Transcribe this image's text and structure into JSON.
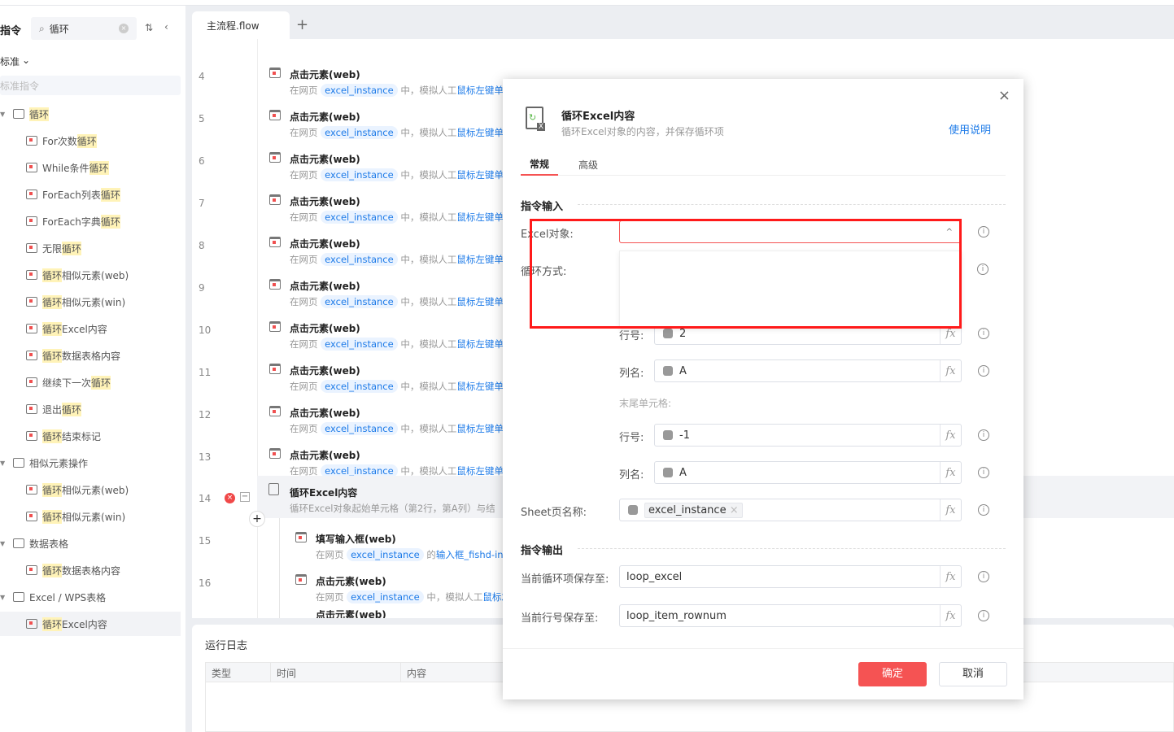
{
  "sidebar": {
    "title": "指令",
    "search_value": "循环",
    "filter": "标准",
    "category_placeholder": "标准指令",
    "items": [
      {
        "type": "cat",
        "pre": "",
        "hl": "循环",
        "post": ""
      },
      {
        "pre": "For次数",
        "hl": "循环",
        "post": ""
      },
      {
        "pre": "While条件",
        "hl": "循环",
        "post": ""
      },
      {
        "pre": "ForEach列表",
        "hl": "循环",
        "post": ""
      },
      {
        "pre": "ForEach字典",
        "hl": "循环",
        "post": ""
      },
      {
        "pre": "无限",
        "hl": "循环",
        "post": ""
      },
      {
        "pre": "",
        "hl": "循环",
        "post": "相似元素(web)"
      },
      {
        "pre": "",
        "hl": "循环",
        "post": "相似元素(win)"
      },
      {
        "pre": "",
        "hl": "循环",
        "post": "Excel内容"
      },
      {
        "pre": "",
        "hl": "循环",
        "post": "数据表格内容"
      },
      {
        "pre": "继续下一次",
        "hl": "循环",
        "post": ""
      },
      {
        "pre": "退出",
        "hl": "循环",
        "post": ""
      },
      {
        "pre": "",
        "hl": "循环",
        "post": "结束标记"
      },
      {
        "type": "cat",
        "pre": "相似元素操作",
        "hl": "",
        "post": ""
      },
      {
        "pre": "",
        "hl": "循环",
        "post": "相似元素(web)"
      },
      {
        "pre": "",
        "hl": "循环",
        "post": "相似元素(win)"
      },
      {
        "type": "cat",
        "pre": "数据表格",
        "hl": "",
        "post": ""
      },
      {
        "pre": "",
        "hl": "循环",
        "post": "数据表格内容"
      },
      {
        "type": "cat",
        "pre": "Excel / WPS表格",
        "hl": "",
        "post": ""
      },
      {
        "pre": "",
        "hl": "循环",
        "post": "Excel内容",
        "selected": true
      }
    ]
  },
  "editor": {
    "tab": "主流程.flow",
    "add_tab": "+",
    "click_title": "点击元素(web)",
    "d_pre": "在网页",
    "d_chip": "excel_instance",
    "d_mid": "中，模拟人工",
    "d_link": "鼠标左键单",
    "lines": [
      "4",
      "5",
      "6",
      "7",
      "8",
      "9",
      "10",
      "11",
      "12",
      "13"
    ],
    "loop_row": {
      "num": "14",
      "title": "循环Excel内容",
      "desc": "循环Excel对象起始单元格（第2行，第A列）与结"
    },
    "nested": [
      {
        "num": "15",
        "title": "填写输入框(web)",
        "pre": "在网页",
        "chip": "excel_instance",
        "mid": "的",
        "link": "输入框_fishd-inp"
      },
      {
        "num": "16",
        "title": "点击元素(web)",
        "pre": "在网页",
        "chip": "excel_instance",
        "mid": "中，模拟人工",
        "link": "鼠标左"
      }
    ],
    "partial_title": "点击元素(web)"
  },
  "log": {
    "title": "运行日志",
    "columns": [
      "类型",
      "时间",
      "内容"
    ]
  },
  "modal": {
    "title": "循环Excel内容",
    "subtitle": "循环Excel对象的内容，并保存循环项",
    "help": "使用说明",
    "tabs": [
      "常规",
      "高级"
    ],
    "input_section": "指令输入",
    "output_section": "指令输出",
    "excel_label": "Excel对象:",
    "loop_label": "循环方式:",
    "row_label": "行号:",
    "col_label": "列名:",
    "end_label": "末尾单元格:",
    "start_row": "2",
    "start_col": "A",
    "end_row": "-1",
    "end_col": "A",
    "sheet_label": "Sheet页名称:",
    "sheet_value": "excel_instance",
    "save_item_label": "当前循环项保存至:",
    "save_item_value": "loop_excel",
    "save_row_label": "当前行号保存至:",
    "save_row_value": "loop_item_rownum",
    "ok": "确定",
    "cancel": "取消"
  },
  "colors": {
    "accent": "#f55353",
    "link": "#1e7be8",
    "highlight": "#fff3b8",
    "annotation": "#ff0000"
  }
}
